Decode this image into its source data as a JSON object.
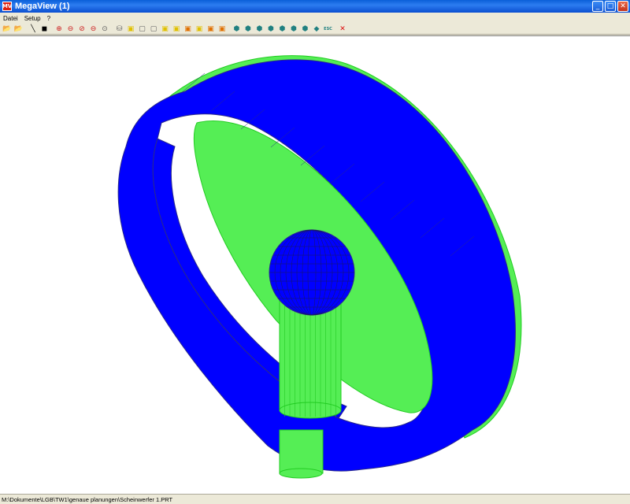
{
  "window": {
    "title": "MegaView (1)",
    "app_icon_label": "MV",
    "controls": {
      "minimize": "_",
      "maximize": "□",
      "close": "✕"
    }
  },
  "menu": {
    "items": [
      {
        "name": "menu-datei",
        "label": "Datei"
      },
      {
        "name": "menu-setup",
        "label": "Setup"
      },
      {
        "name": "menu-help",
        "label": "?"
      }
    ]
  },
  "toolbar": {
    "buttons": [
      {
        "name": "open-folder-icon",
        "glyph": "📂",
        "color": "#d4a020"
      },
      {
        "name": "open-folder-alt-icon",
        "glyph": "📂",
        "color": "#d4a020"
      },
      {
        "sep": true
      },
      {
        "name": "wireframe-icon",
        "glyph": "╲",
        "color": "#000000"
      },
      {
        "name": "solid-icon",
        "glyph": "◼",
        "color": "#000000"
      },
      {
        "sep": true
      },
      {
        "name": "zoom-in-icon",
        "glyph": "⊕",
        "color": "#cc2020"
      },
      {
        "name": "zoom-out-icon",
        "glyph": "⊖",
        "color": "#cc2020"
      },
      {
        "name": "zoom-window-icon",
        "glyph": "⊘",
        "color": "#cc2020"
      },
      {
        "name": "zoom-previous-icon",
        "glyph": "⊖",
        "color": "#cc2020"
      },
      {
        "name": "zoom-all-icon",
        "glyph": "⊙",
        "color": "#606060"
      },
      {
        "sep": true
      },
      {
        "name": "view-bottom-icon",
        "glyph": "⛁",
        "color": "#606060"
      },
      {
        "name": "view-front-icon",
        "glyph": "▣",
        "color": "#e0c000"
      },
      {
        "name": "view-back-icon",
        "glyph": "▢",
        "color": "#606060"
      },
      {
        "name": "view-left-icon",
        "glyph": "▢",
        "color": "#606060"
      },
      {
        "name": "view-right-icon",
        "glyph": "▣",
        "color": "#e0c000"
      },
      {
        "name": "view-top-icon",
        "glyph": "▣",
        "color": "#e0c000"
      },
      {
        "name": "view-iso-1-icon",
        "glyph": "▣",
        "color": "#e07000"
      },
      {
        "name": "view-iso-2-icon",
        "glyph": "▣",
        "color": "#e0c000"
      },
      {
        "name": "view-iso-3-icon",
        "glyph": "▣",
        "color": "#e07000"
      },
      {
        "name": "view-iso-4-icon",
        "glyph": "▣",
        "color": "#e07000"
      },
      {
        "sep": true
      },
      {
        "name": "rotate-1-icon",
        "glyph": "⬢",
        "color": "#208080"
      },
      {
        "name": "rotate-2-icon",
        "glyph": "⬢",
        "color": "#208080"
      },
      {
        "name": "rotate-3-icon",
        "glyph": "⬢",
        "color": "#208080"
      },
      {
        "name": "rotate-4-icon",
        "glyph": "⬢",
        "color": "#208080"
      },
      {
        "name": "rotate-5-icon",
        "glyph": "⬢",
        "color": "#208080"
      },
      {
        "name": "rotate-6-icon",
        "glyph": "⬢",
        "color": "#208080"
      },
      {
        "name": "rotate-7-icon",
        "glyph": "⬢",
        "color": "#208080"
      },
      {
        "name": "rotate-8-icon",
        "glyph": "◆",
        "color": "#208080"
      },
      {
        "name": "escape-icon",
        "glyph": "ESC",
        "color": "#208080"
      },
      {
        "sep": true
      },
      {
        "name": "close-model-icon",
        "glyph": "✕",
        "color": "#dd1010"
      }
    ]
  },
  "model_colors": {
    "ring": "#0000ff",
    "ring_edge": "#2a2a8a",
    "face": "#55ee55",
    "face_edge": "#22cc22"
  },
  "status": {
    "path": "M:\\Dokumente\\LGB\\TW1\\genaue planungen\\Scheinwerfer 1.PRT"
  }
}
